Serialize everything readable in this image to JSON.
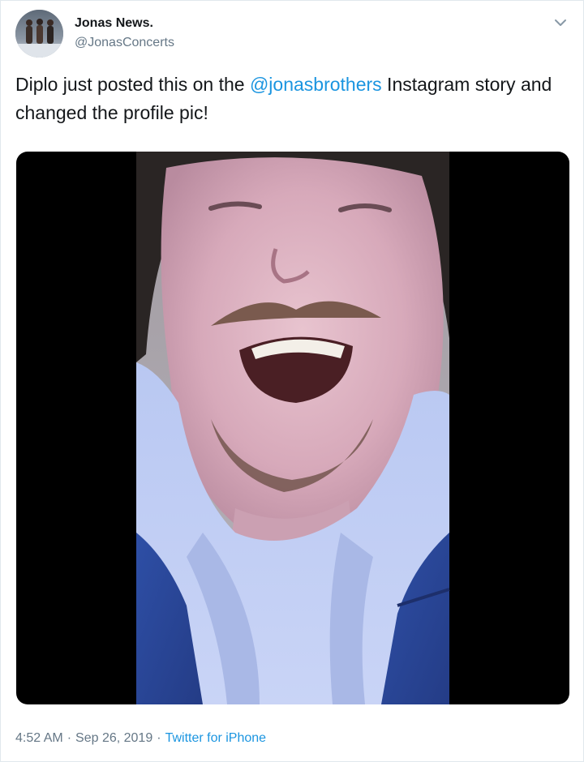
{
  "tweet": {
    "author_name": "Jonas News.",
    "author_handle": "@JonasConcerts",
    "text_before": "Diplo just posted this on the ",
    "mention": "@jonasbrothers",
    "text_after": " Instagram story and changed the profile pic!",
    "time": "4:52 AM",
    "separator": "·",
    "date": "Sep 26, 2019",
    "source": "Twitter for iPhone"
  },
  "icons": {
    "menu": "chevron-down-icon",
    "avatar": "avatar-image",
    "media": "video-still"
  },
  "colors": {
    "link": "#1b95e0",
    "secondary_text": "#657786",
    "primary_text": "#14171a",
    "border": "#e1e8ed"
  }
}
